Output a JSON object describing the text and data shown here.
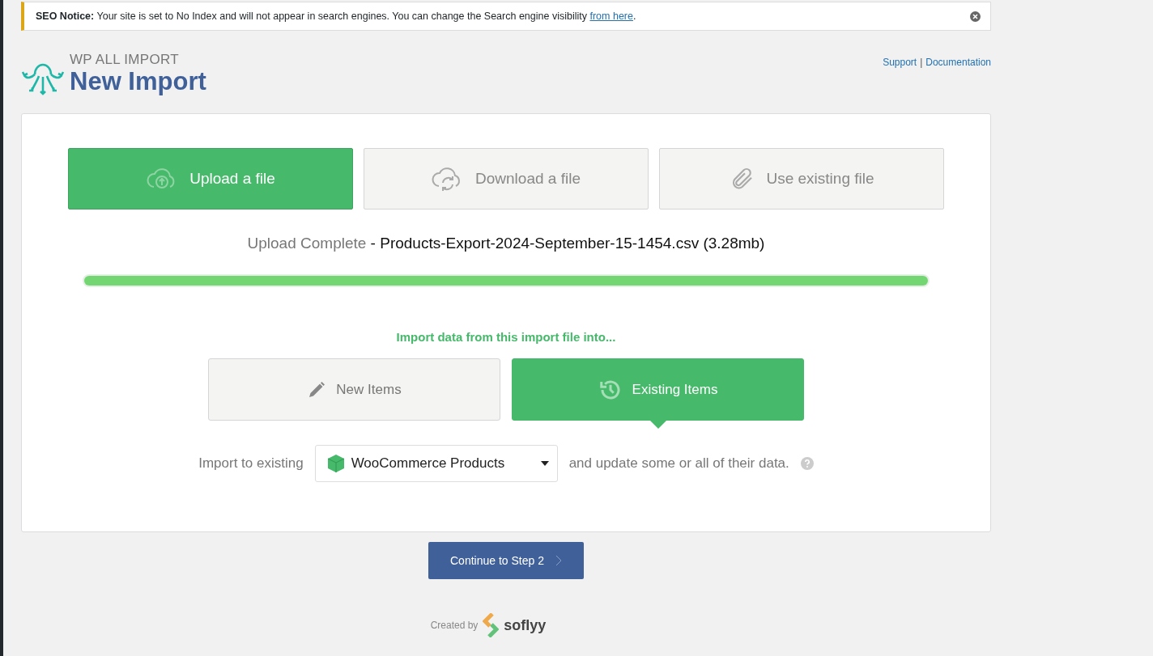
{
  "notice": {
    "text": "**SEO Notice:** Your site is set to No Index and will not appear in search engines. You can change the Search engine visibility ",
    "link": "from here",
    "tail": "."
  },
  "header": {
    "brand": "WP ALL IMPORT",
    "title": "New Import",
    "links": [
      {
        "label": "Support"
      },
      {
        "label": "Documentation"
      }
    ],
    "separator": "|"
  },
  "sources": [
    {
      "label": "Upload a file",
      "kind": "upload",
      "selected": true
    },
    {
      "label": "Download a file",
      "kind": "download",
      "selected": false
    },
    {
      "label": "Use existing file",
      "kind": "existing",
      "selected": false
    }
  ],
  "upload": {
    "status": "Upload Complete",
    "file": " - Products-Export-2024-September-15-1454.csv (3.28mb)",
    "level": 1
  },
  "target": {
    "prompt": "Import data from this import file into...",
    "options": [
      {
        "label": "New Items",
        "kind": "new",
        "selected": false
      },
      {
        "label": "Existing Items",
        "kind": "existing",
        "selected": true
      }
    ]
  },
  "existing": {
    "before": "Import to existing",
    "select": "WooCommerce Products",
    "after": "and update some or all of their data."
  },
  "continue": "Continue to Step 2",
  "footer": {
    "created": "Created by",
    "brand": "soflyy"
  }
}
